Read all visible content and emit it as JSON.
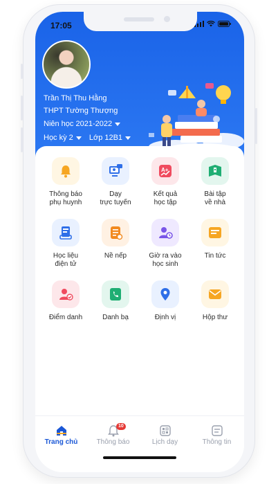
{
  "status_bar": {
    "time": "17:05"
  },
  "profile": {
    "name": "Trần Thị Thu Hằng",
    "school": "THPT Tường Thượng",
    "year_label": "Niên học 2021-2022",
    "semester_label": "Học kỳ 2",
    "class_label": "Lớp 12B1"
  },
  "menu": [
    {
      "label_lines": [
        "Thông báo",
        "phụ huynh"
      ],
      "icon": "bell-icon",
      "bg": "#fff6e3",
      "color": "#f6a623"
    },
    {
      "label_lines": [
        "Dạy",
        "trực tuyến"
      ],
      "icon": "online-class-icon",
      "bg": "#e9f1ff",
      "color": "#2f6fe8"
    },
    {
      "label_lines": [
        "Kết quả",
        "học tập"
      ],
      "icon": "grade-chart-icon",
      "bg": "#fde7ea",
      "color": "#f04b5f"
    },
    {
      "label_lines": [
        "Bài tập",
        "về nhà"
      ],
      "icon": "homework-book-icon",
      "bg": "#e3f6ee",
      "color": "#1fae73"
    },
    {
      "label_lines": [
        "Học liệu",
        "điện tử"
      ],
      "icon": "e-learning-icon",
      "bg": "#e9f1ff",
      "color": "#2f6fe8"
    },
    {
      "label_lines": [
        "Nề nếp"
      ],
      "icon": "checklist-icon",
      "bg": "#fff1e3",
      "color": "#f28a1f"
    },
    {
      "label_lines": [
        "Giờ ra vào",
        "học sinh"
      ],
      "icon": "student-clock-icon",
      "bg": "#efe9ff",
      "color": "#7a56e8"
    },
    {
      "label_lines": [
        "Tin tức"
      ],
      "icon": "news-icon",
      "bg": "#fff6e3",
      "color": "#f6a623"
    },
    {
      "label_lines": [
        "Điểm danh"
      ],
      "icon": "attendance-icon",
      "bg": "#fde7ea",
      "color": "#f04b5f"
    },
    {
      "label_lines": [
        "Danh bạ"
      ],
      "icon": "contacts-icon",
      "bg": "#e3f6ee",
      "color": "#1fae73"
    },
    {
      "label_lines": [
        "Định vị"
      ],
      "icon": "location-icon",
      "bg": "#e9f1ff",
      "color": "#2f6fe8"
    },
    {
      "label_lines": [
        "Hộp thư"
      ],
      "icon": "mailbox-icon",
      "bg": "#fff6e3",
      "color": "#f6a623"
    }
  ],
  "tabbar": {
    "tabs": [
      {
        "label": "Trang chủ",
        "icon": "home-icon",
        "active": true
      },
      {
        "label": "Thông báo",
        "icon": "bell-icon",
        "badge": "10"
      },
      {
        "label": "Lịch dạy",
        "icon": "calendar-icon"
      },
      {
        "label": "Thông tin",
        "icon": "info-icon"
      }
    ]
  },
  "colors": {
    "primary": "#1a63e8",
    "active_tab": "#1a57d6",
    "badge": "#e53935"
  }
}
